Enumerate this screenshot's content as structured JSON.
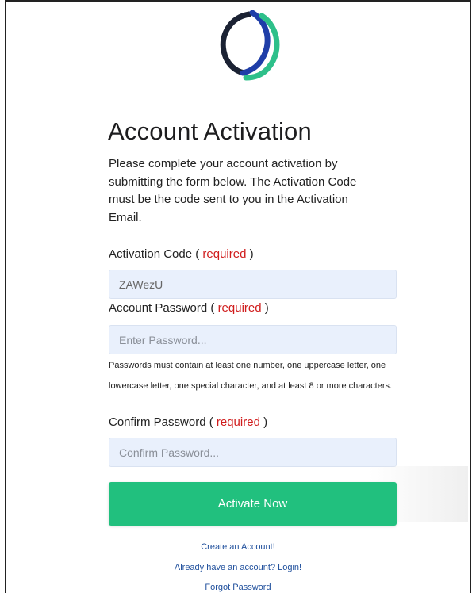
{
  "colors": {
    "accent": "#21c07e",
    "required": "#d01d1d",
    "input_bg": "#e9f0fc",
    "link": "#1f4f9c",
    "logo_dark": "#1b2233",
    "logo_blue": "#1f3ea8",
    "logo_green": "#2ec08a"
  },
  "logo": {
    "icon": "brand-logo-icon"
  },
  "page": {
    "title": "Account Activation",
    "intro": "Please complete your account activation by submitting the form below. The Activation Code must be the code sent to you in the Activation Email."
  },
  "form": {
    "activation_code": {
      "label": "Activation Code ( ",
      "required": "required",
      "label_end": " )",
      "value": "ZAWezU",
      "placeholder": ""
    },
    "password": {
      "label": "Account Password ( ",
      "required": "required",
      "label_end": " )",
      "value": "",
      "placeholder": "Enter Password..."
    },
    "password_hint": "Passwords must contain at least one number, one uppercase letter, one lowercase letter, one special character, and at least 8 or more characters.",
    "confirm_password": {
      "label": "Confirm Password ( ",
      "required": "required",
      "label_end": " )",
      "value": "",
      "placeholder": "Confirm Password..."
    },
    "submit_label": "Activate Now"
  },
  "links": {
    "create_account": "Create an Account!",
    "login": "Already have an account? Login!",
    "forgot_password": "Forgot Password"
  }
}
